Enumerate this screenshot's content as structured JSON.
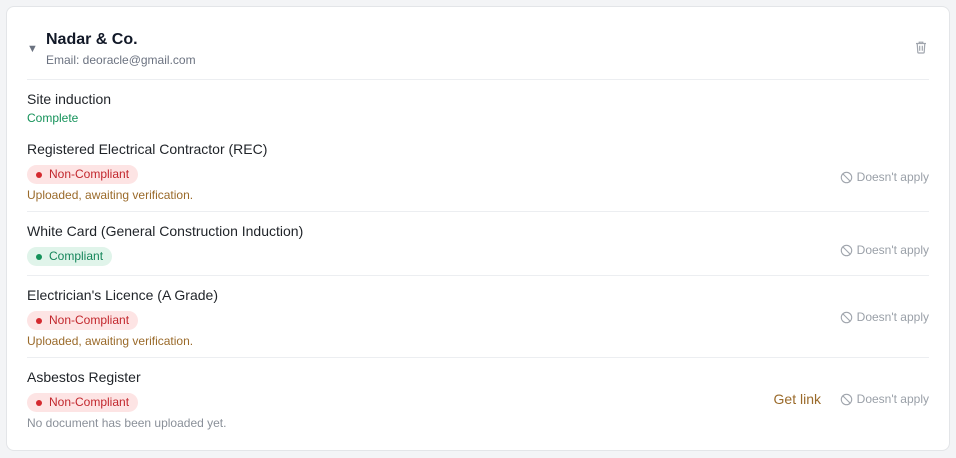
{
  "company": {
    "name": "Nadar & Co.",
    "email": "Email: deoracle@gmail.com"
  },
  "site_induction": {
    "title": "Site induction",
    "status": "Complete"
  },
  "requirements": [
    {
      "title": "Registered Electrical Contractor (REC)",
      "badge": "Non-Compliant",
      "note": "Uploaded, awaiting verification.",
      "action": "Doesn't apply"
    },
    {
      "title": "White Card (General Construction Induction)",
      "badge": "Compliant",
      "note": "",
      "action": "Doesn't apply"
    },
    {
      "title": "Electrician's Licence (A Grade)",
      "badge": "Non-Compliant",
      "note": "Uploaded, awaiting verification.",
      "action": "Doesn't apply"
    },
    {
      "title": "Asbestos Register",
      "badge": "Non-Compliant",
      "note": "No document has been uploaded yet.",
      "action": "Doesn't apply",
      "link": "Get link"
    }
  ],
  "colors": {
    "compliant": "#15925a",
    "non_compliant": "#c2272d",
    "awaiting": "#9a6a2a"
  }
}
